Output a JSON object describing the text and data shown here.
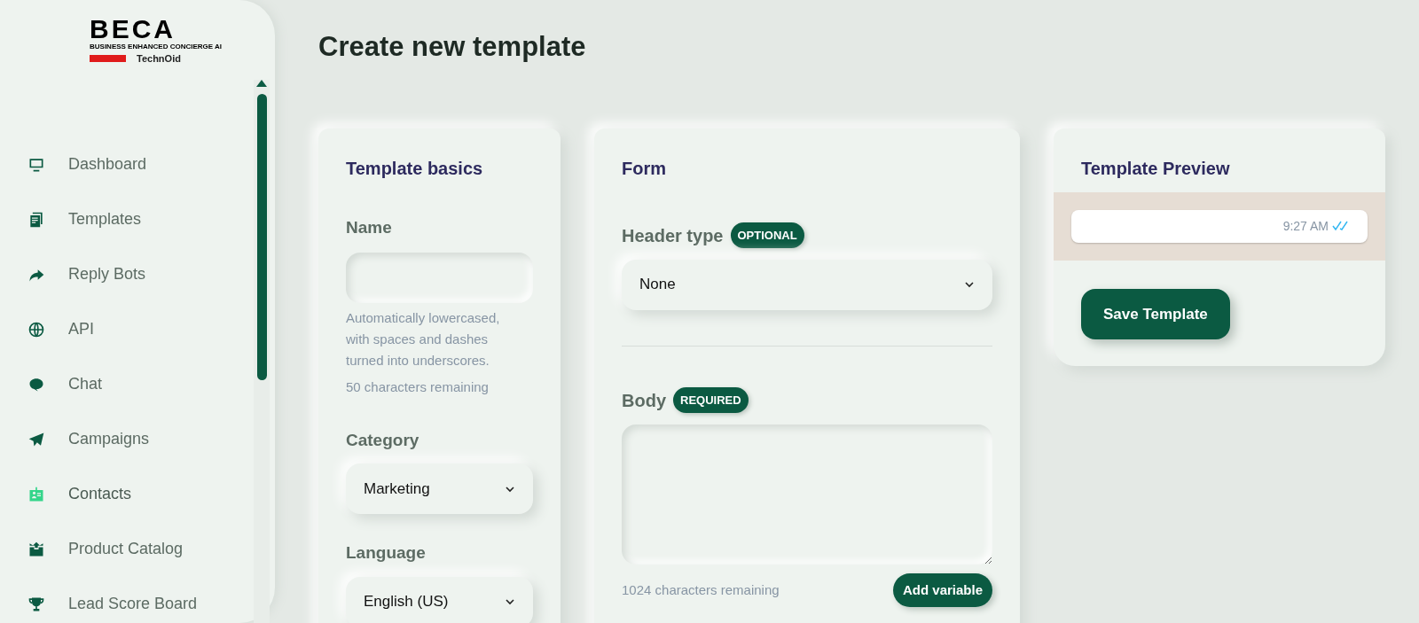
{
  "logo": {
    "wordmark": "BECA",
    "tagline": "BUSINESS ENHANCED CONCIERGE AI",
    "brand": "TechnOid"
  },
  "sidebar": {
    "items": [
      {
        "label": "Dashboard",
        "kind": "monitor",
        "selected": false
      },
      {
        "label": "Templates",
        "kind": "document",
        "selected": false
      },
      {
        "label": "Reply Bots",
        "kind": "share",
        "selected": false
      },
      {
        "label": "API",
        "kind": "globe",
        "selected": false
      },
      {
        "label": "Chat",
        "kind": "chat",
        "selected": false
      },
      {
        "label": "Campaigns",
        "kind": "send",
        "selected": false
      },
      {
        "label": "Contacts",
        "kind": "idcard",
        "selected": true
      },
      {
        "label": "Product Catalog",
        "kind": "box",
        "selected": false
      },
      {
        "label": "Lead Score Board",
        "kind": "trophy",
        "selected": false
      }
    ]
  },
  "page_title": "Create new template",
  "basics": {
    "title": "Template basics",
    "name": {
      "label": "Name",
      "help": "Automatically lowercased, with spaces and dashes turned into underscores.",
      "counter": "50 characters remaining"
    },
    "category": {
      "label": "Category",
      "value": "Marketing"
    },
    "language": {
      "label": "Language",
      "value": "English (US)"
    }
  },
  "form": {
    "title": "Form",
    "header_type": {
      "label": "Header type",
      "badge": "OPTIONAL",
      "value": "None"
    },
    "body": {
      "label": "Body",
      "badge": "REQUIRED",
      "counter": "1024 characters remaining",
      "button": "Add variable"
    }
  },
  "preview": {
    "title": "Template Preview",
    "time": "9:27 AM",
    "read": true,
    "button": "Save Template"
  }
}
